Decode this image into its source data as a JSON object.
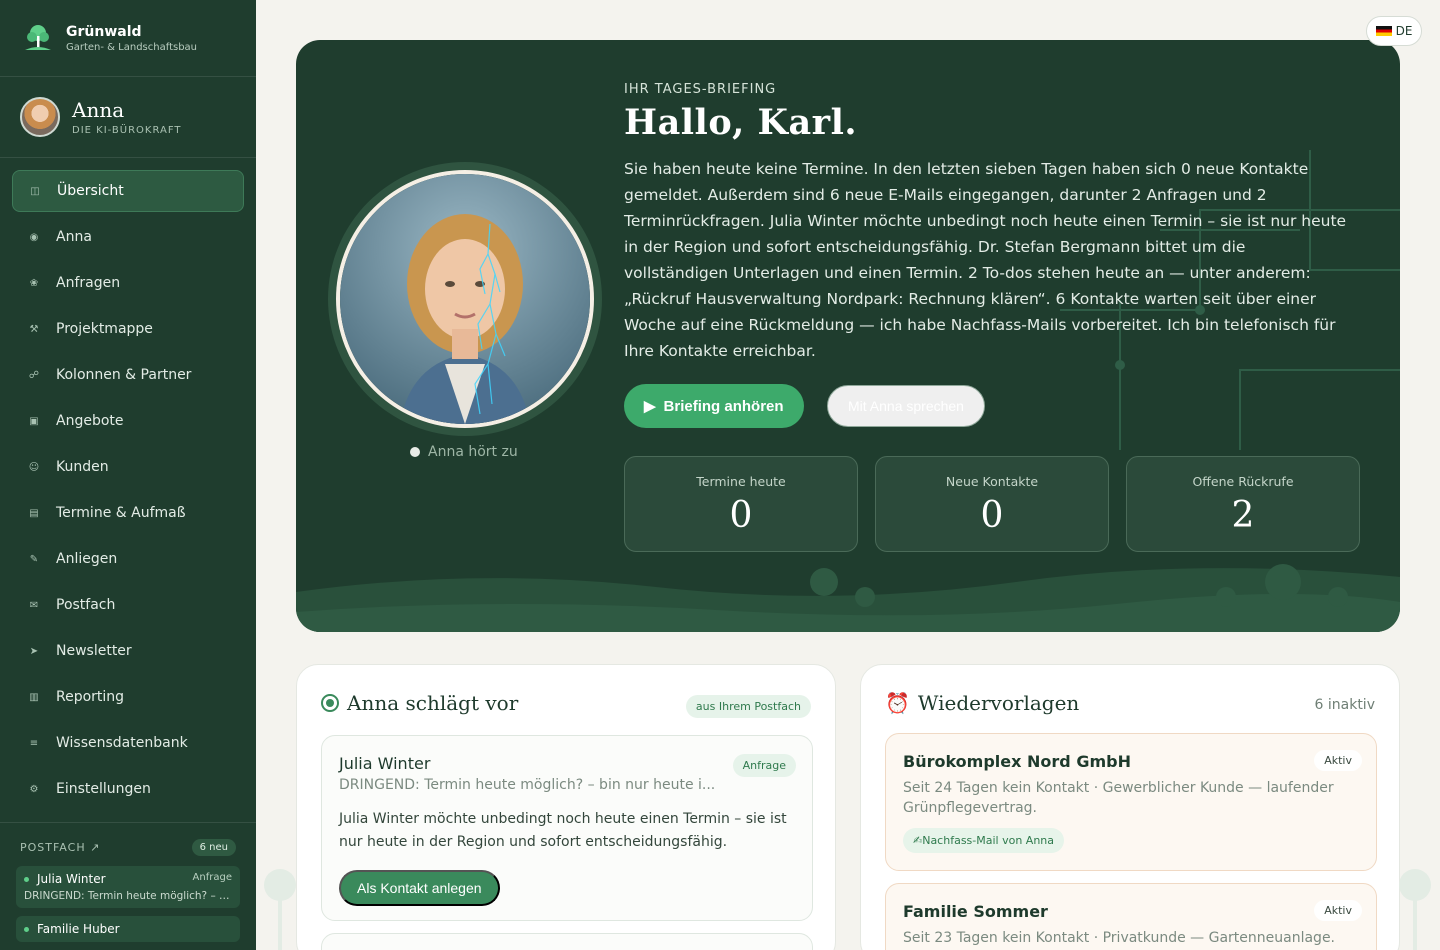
{
  "brand": {
    "name": "Grünwald",
    "subtitle": "Garten- & Landschaftsbau"
  },
  "agent": {
    "name": "Anna",
    "role": "DIE KI-BÜROKRAFT"
  },
  "nav": [
    {
      "label": "Übersicht",
      "icon": "dashboard-icon",
      "glyph": "◫",
      "active": true
    },
    {
      "label": "Anna",
      "icon": "agent-icon",
      "glyph": "◉"
    },
    {
      "label": "Anfragen",
      "icon": "flower-icon",
      "glyph": "❀"
    },
    {
      "label": "Projektmappe",
      "icon": "tools-icon",
      "glyph": "⚒"
    },
    {
      "label": "Kolonnen & Partner",
      "icon": "people-icon",
      "glyph": "☍"
    },
    {
      "label": "Angebote",
      "icon": "document-icon",
      "glyph": "▣"
    },
    {
      "label": "Kunden",
      "icon": "customer-icon",
      "glyph": "☺"
    },
    {
      "label": "Termine & Aufmaß",
      "icon": "calendar-icon",
      "glyph": "▤"
    },
    {
      "label": "Anliegen",
      "icon": "pen-icon",
      "glyph": "✎"
    },
    {
      "label": "Postfach",
      "icon": "mail-icon",
      "glyph": "✉"
    },
    {
      "label": "Newsletter",
      "icon": "send-icon",
      "glyph": "➤"
    },
    {
      "label": "Reporting",
      "icon": "chart-icon",
      "glyph": "▥"
    },
    {
      "label": "Wissensdatenbank",
      "icon": "list-icon",
      "glyph": "≡"
    },
    {
      "label": "Einstellungen",
      "icon": "gear-icon",
      "glyph": "⚙"
    }
  ],
  "inbox": {
    "title": "POSTFACH ↗",
    "badge": "6 neu",
    "items": [
      {
        "name": "Julia Winter",
        "tag": "Anfrage",
        "subject": "DRINGEND: Termin heute möglich? – bin nur heute i..."
      },
      {
        "name": "Familie Huber",
        "tag": "",
        "subject": ""
      }
    ]
  },
  "language": {
    "code": "DE"
  },
  "hero": {
    "kicker": "IHR TAGES-BRIEFING",
    "greeting": "Hallo, Karl.",
    "briefing": "Sie haben heute keine Termine. In den letzten sieben Tagen haben sich 0 neue Kontakte gemeldet. Außerdem sind 6 neue E-Mails eingegangen, darunter 2 Anfragen und 2 Terminrückfragen. Julia Winter möchte unbedingt noch heute einen Termin – sie ist nur heute in der Region und sofort entscheidungsfähig. Dr. Stefan Bergmann bittet um die vollständigen Unterlagen und einen Termin. 2 To-dos stehen heute an — unter anderem: „Rückruf Hausverwaltung Nordpark: Rechnung klären“. 6 Kontakte warten seit über einer Woche auf eine Rückmeldung — ich habe Nachfass-Mails vorbereitet. Ich bin telefonisch für Ihre Kontakte erreichbar.",
    "listen_status": "Anna hört zu",
    "play_button": "Briefing anhören",
    "talk_button": "Mit Anna sprechen",
    "stats": [
      {
        "label": "Termine heute",
        "value": "0"
      },
      {
        "label": "Neue Kontakte",
        "value": "0"
      },
      {
        "label": "Offene Rückrufe",
        "value": "2"
      }
    ]
  },
  "suggestions": {
    "title": "Anna schlägt vor",
    "chip": "aus Ihrem Postfach",
    "item": {
      "name": "Julia Winter",
      "tag": "Anfrage",
      "subject": "DRINGEND: Termin heute möglich? – bin nur heute i...",
      "body": "Julia Winter möchte unbedingt noch heute einen Termin – sie ist nur heute in der Region und sofort entscheidungsfähig.",
      "action": "Als Kontakt anlegen"
    }
  },
  "followups": {
    "title": "Wiedervorlagen",
    "count": "6 inaktiv",
    "items": [
      {
        "name": "Bürokomplex Nord GmbH",
        "status": "Aktiv",
        "desc": "Seit 24 Tagen kein Kontakt · Gewerblicher Kunde — laufender Grünpflegevertrag.",
        "mail": "✍Nachfass-Mail von Anna"
      },
      {
        "name": "Familie Sommer",
        "status": "Aktiv",
        "desc": "Seit 23 Tagen kein Kontakt · Privatkunde — Gartenneuanlage."
      }
    ]
  },
  "colors": {
    "primary": "#1f3d2e",
    "accent": "#3daa6b",
    "background": "#f4f3ee"
  }
}
